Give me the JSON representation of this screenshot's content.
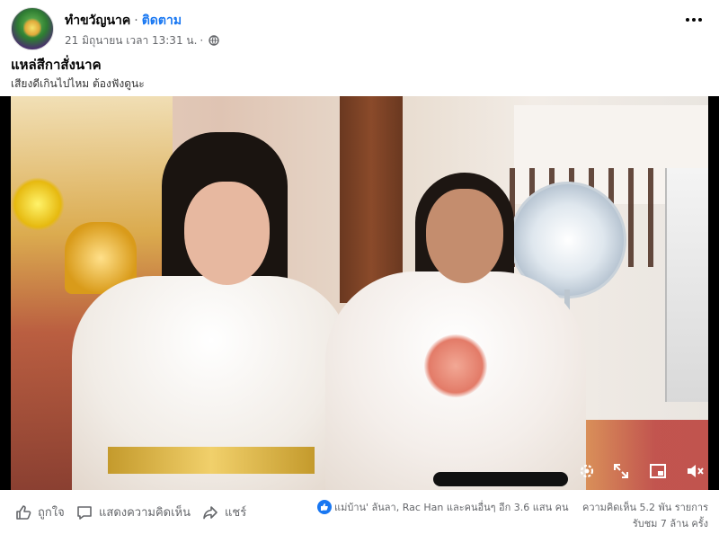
{
  "header": {
    "page_name": "ทำขวัญนาค",
    "separator": "·",
    "follow_label": "ติดตาม",
    "timestamp": "21 มิถุนายน เวลา 13:31 น.",
    "privacy_icon": "globe-icon",
    "more_icon": "more-options-icon"
  },
  "post": {
    "title": "แหล่สีกาสั่งนาค",
    "subtitle": "เสียงดีเกินไปไหม ต้องฟังดูนะ"
  },
  "video": {
    "controls": [
      "settings-icon",
      "fullscreen-icon",
      "picture-in-picture-icon",
      "mute-icon"
    ]
  },
  "actions": {
    "like_label": "ถูกใจ",
    "comment_label": "แสดงความคิดเห็น",
    "share_label": "แชร์"
  },
  "engagement": {
    "reactions_text": "แม่บ้าน' ลันลา, Rac Han และคนอื่นๆ อีก 3.6 แสน คน",
    "comments_text": "ความคิดเห็น 5.2 พัน รายการ",
    "views_text": "รับชม 7 ล้าน ครั้ง"
  },
  "colors": {
    "accent": "#1877f2",
    "secondary_text": "#65676b",
    "video_bg": "#000000"
  }
}
